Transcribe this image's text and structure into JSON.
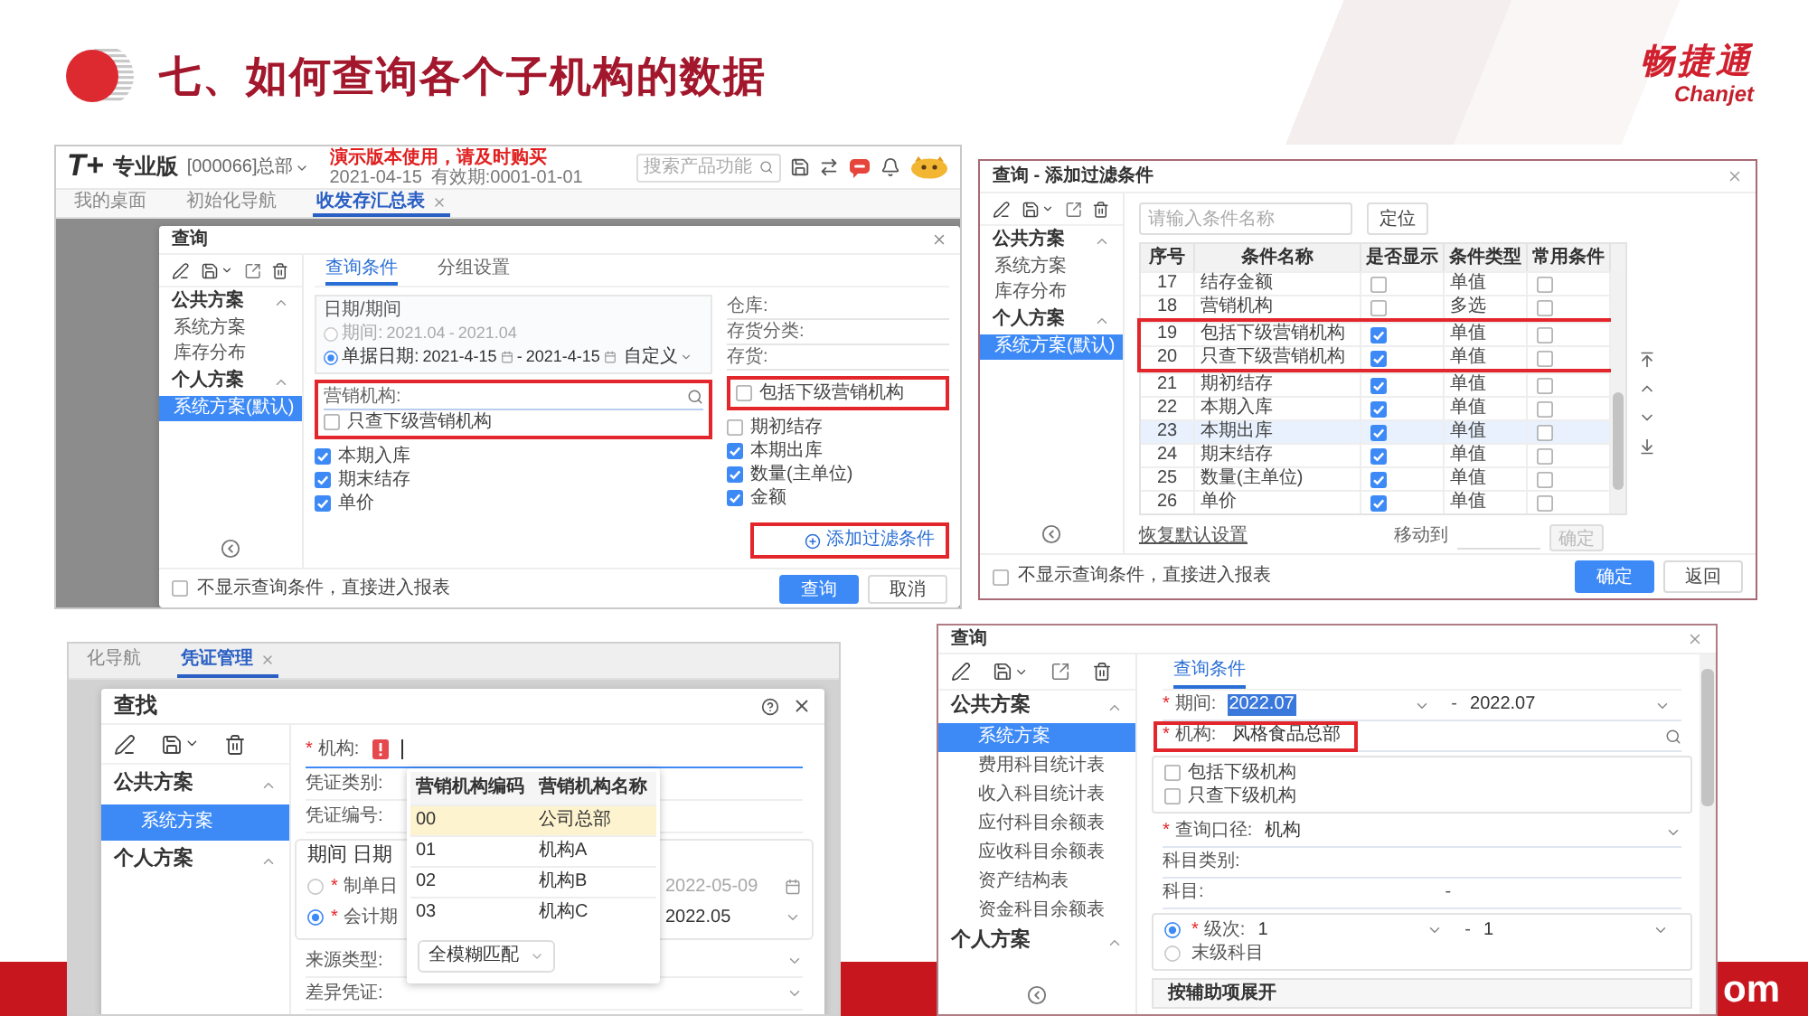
{
  "header": {
    "title": "七、如何查询各个子机构的数据",
    "brand_name": "畅捷通",
    "brand_latin": "Chanjet"
  },
  "footer": {
    "text": "om"
  },
  "shot_report_query": {
    "app_bar": {
      "logo": "T+",
      "edition": "专业版",
      "account": "[000066]总部",
      "notice": "演示版本使用，请及时购买",
      "date": "2021-04-15",
      "validity": "有效期:0001-01-01",
      "search_placeholder": "搜索产品功能"
    },
    "tabs": [
      {
        "label": "我的桌面",
        "selected": false,
        "closable": false
      },
      {
        "label": "初始化导航",
        "selected": false,
        "closable": false
      },
      {
        "label": "收发存汇总表",
        "selected": true,
        "closable": true
      }
    ],
    "dialog": {
      "title": "查询",
      "schemes": [
        {
          "label": "公共方案",
          "expanded": true,
          "children": [
            {
              "label": "系统方案",
              "selected": false
            },
            {
              "label": "库存分布",
              "selected": false
            }
          ]
        },
        {
          "label": "个人方案",
          "expanded": true,
          "children": [
            {
              "label": "系统方案(默认)",
              "selected": true
            }
          ]
        }
      ],
      "tabs": [
        {
          "label": "查询条件",
          "selected": true
        },
        {
          "label": "分组设置",
          "selected": false
        }
      ],
      "date_group": {
        "title": "日期/期间",
        "options": [
          {
            "kind": "period",
            "label": "期间:",
            "from": "2021.04",
            "separator": "-",
            "to": "2021.04",
            "selected": false
          },
          {
            "kind": "date",
            "label": "单据日期:",
            "from": "2021-4-15",
            "separator": "-",
            "to": "2021-4-15",
            "selected": true,
            "preset": "自定义"
          }
        ]
      },
      "left_items": [
        {
          "kind": "highlight",
          "items": [
            {
              "kind": "lookup",
              "label": "营销机构:"
            },
            {
              "kind": "checkbox",
              "label": "只查下级营销机构",
              "checked": false
            }
          ]
        },
        {
          "kind": "checkbox",
          "label": "本期入库",
          "checked": true
        },
        {
          "kind": "checkbox",
          "label": "期末结存",
          "checked": true
        },
        {
          "kind": "checkbox",
          "label": "单价",
          "checked": true
        }
      ],
      "right_items": [
        {
          "kind": "field",
          "label": "仓库:"
        },
        {
          "kind": "field",
          "label": "存货分类:"
        },
        {
          "kind": "field",
          "label": "存货:"
        },
        {
          "kind": "highlight",
          "items": [
            {
              "kind": "checkbox",
              "label": "包括下级营销机构",
              "checked": false
            }
          ]
        },
        {
          "kind": "checkbox",
          "label": "期初结存",
          "checked": false
        },
        {
          "kind": "checkbox",
          "label": "本期出库",
          "checked": true
        },
        {
          "kind": "checkbox",
          "label": "数量(主单位)",
          "checked": true
        },
        {
          "kind": "checkbox",
          "label": "金额",
          "checked": true
        }
      ],
      "add_filter": {
        "label": "添加过滤条件",
        "highlighted": true
      },
      "skip_option": {
        "label": "不显示查询条件，直接进入报表",
        "checked": false
      },
      "buttons": [
        {
          "label": "查询",
          "kind": "primary"
        },
        {
          "label": "取消",
          "kind": "secondary"
        }
      ]
    }
  },
  "shot_add_filter": {
    "title": "查询 - 添加过滤条件",
    "schemes": [
      {
        "label": "公共方案",
        "expanded": true,
        "children": [
          {
            "label": "系统方案",
            "selected": false
          },
          {
            "label": "库存分布",
            "selected": false
          }
        ]
      },
      {
        "label": "个人方案",
        "expanded": true,
        "children": [
          {
            "label": "系统方案(默认)",
            "selected": true
          }
        ]
      }
    ],
    "search_placeholder": "请输入条件名称",
    "locate_button": "定位",
    "table": {
      "columns": [
        "序号",
        "条件名称",
        "是否显示",
        "条件类型",
        "常用条件"
      ],
      "rows": [
        {
          "index": "17",
          "name": "结存金额",
          "visible": false,
          "type": "单值",
          "common": false,
          "selected": false,
          "highlighted": false
        },
        {
          "index": "18",
          "name": "营销机构",
          "visible": false,
          "type": "多选",
          "common": false,
          "selected": false,
          "highlighted": false
        },
        {
          "index": "19",
          "name": "包括下级营销机构",
          "visible": true,
          "type": "单值",
          "common": false,
          "selected": false,
          "highlighted": true
        },
        {
          "index": "20",
          "name": "只查下级营销机构",
          "visible": true,
          "type": "单值",
          "common": false,
          "selected": false,
          "highlighted": true
        },
        {
          "index": "21",
          "name": "期初结存",
          "visible": true,
          "type": "单值",
          "common": false,
          "selected": false,
          "highlighted": false
        },
        {
          "index": "22",
          "name": "本期入库",
          "visible": true,
          "type": "单值",
          "common": false,
          "selected": false,
          "highlighted": false
        },
        {
          "index": "23",
          "name": "本期出库",
          "visible": true,
          "type": "单值",
          "common": false,
          "selected": true,
          "highlighted": false
        },
        {
          "index": "24",
          "name": "期末结存",
          "visible": true,
          "type": "单值",
          "common": false,
          "selected": false,
          "highlighted": false
        },
        {
          "index": "25",
          "name": "数量(主单位)",
          "visible": true,
          "type": "单值",
          "common": false,
          "selected": false,
          "highlighted": false
        },
        {
          "index": "26",
          "name": "单价",
          "visible": true,
          "type": "单值",
          "common": false,
          "selected": false,
          "highlighted": false
        }
      ]
    },
    "restore_link": "恢复默认设置",
    "move_label": "移动到",
    "move_button": {
      "label": "确定",
      "disabled": true
    },
    "skip_option": {
      "label": "不显示查询条件，直接进入报表",
      "checked": false
    },
    "buttons": [
      {
        "label": "确定",
        "kind": "primary"
      },
      {
        "label": "返回",
        "kind": "secondary"
      }
    ]
  },
  "shot_voucher_find": {
    "tabs": [
      {
        "label": "化导航",
        "selected": false,
        "closable": false
      },
      {
        "label": "凭证管理",
        "selected": true,
        "closable": true
      }
    ],
    "dialog": {
      "title": "查找",
      "schemes": [
        {
          "label": "公共方案",
          "expanded": true,
          "children": [
            {
              "label": "系统方案",
              "selected": true
            }
          ]
        },
        {
          "label": "个人方案",
          "expanded": true
        }
      ],
      "org_field": {
        "required": "*",
        "label": "机构:"
      },
      "fields_top": [
        {
          "kind": "field",
          "label": "凭证类别:"
        },
        {
          "kind": "field",
          "label": "凭证编号:"
        }
      ],
      "period_group": {
        "title": "期间 日期",
        "options": [
          {
            "kind": "date",
            "required": "*",
            "label": "制单日",
            "value": "2022-05-09",
            "selected": false
          },
          {
            "kind": "select",
            "required": "*",
            "label": "会计期",
            "value": "2022.05",
            "selected": true
          }
        ]
      },
      "fields_bottom": [
        {
          "kind": "select",
          "label": "来源类型:"
        },
        {
          "kind": "select",
          "label": "差异凭证:"
        }
      ],
      "org_popup": {
        "columns": [
          "营销机构编码",
          "营销机构名称"
        ],
        "rows": [
          {
            "code": "00",
            "name": "公司总部",
            "selected": true
          },
          {
            "code": "01",
            "name": "机构A",
            "selected": false
          },
          {
            "code": "02",
            "name": "机构B",
            "selected": false
          },
          {
            "code": "03",
            "name": "机构C",
            "selected": false
          }
        ],
        "match_mode": "全模糊匹配"
      }
    }
  },
  "shot_balance_query": {
    "title": "查询",
    "schemes": [
      {
        "label": "公共方案",
        "expanded": true,
        "children": [
          {
            "label": "系统方案",
            "selected": true
          },
          {
            "label": "费用科目统计表",
            "selected": false
          },
          {
            "label": "收入科目统计表",
            "selected": false
          },
          {
            "label": "应付科目余额表",
            "selected": false
          },
          {
            "label": "应收科目余额表",
            "selected": false
          },
          {
            "label": "资产结构表",
            "selected": false
          },
          {
            "label": "资金科目余额表",
            "selected": false
          }
        ]
      },
      {
        "label": "个人方案",
        "expanded": true
      }
    ],
    "tabs": [
      {
        "label": "查询条件",
        "selected": true
      }
    ],
    "fields": [
      {
        "kind": "range_select",
        "required": "*",
        "label": "期间:",
        "from": "2022.07",
        "from_selected": true,
        "separator": "-",
        "to": "2022.07"
      },
      {
        "kind": "lookup",
        "required": "*",
        "label": "机构:",
        "value": "风格食品总部",
        "highlighted": true
      },
      {
        "kind": "checks",
        "items": [
          {
            "label": "包括下级机构",
            "checked": false
          },
          {
            "label": "只查下级机构",
            "checked": false
          }
        ]
      },
      {
        "kind": "select",
        "required": "*",
        "label": "查询口径:",
        "value": "机构"
      },
      {
        "kind": "field",
        "label": "科目类别:"
      },
      {
        "kind": "range",
        "label": "科目:",
        "separator": "-"
      },
      {
        "kind": "level",
        "options": [
          {
            "kind": "range_select",
            "selected": true,
            "required": "*",
            "label": "级次:",
            "from": "1",
            "separator": "-",
            "to": "1"
          },
          {
            "kind": "plain",
            "selected": false,
            "label": "末级科目"
          }
        ]
      },
      {
        "kind": "section",
        "label": "按辅助项展开"
      }
    ]
  }
}
